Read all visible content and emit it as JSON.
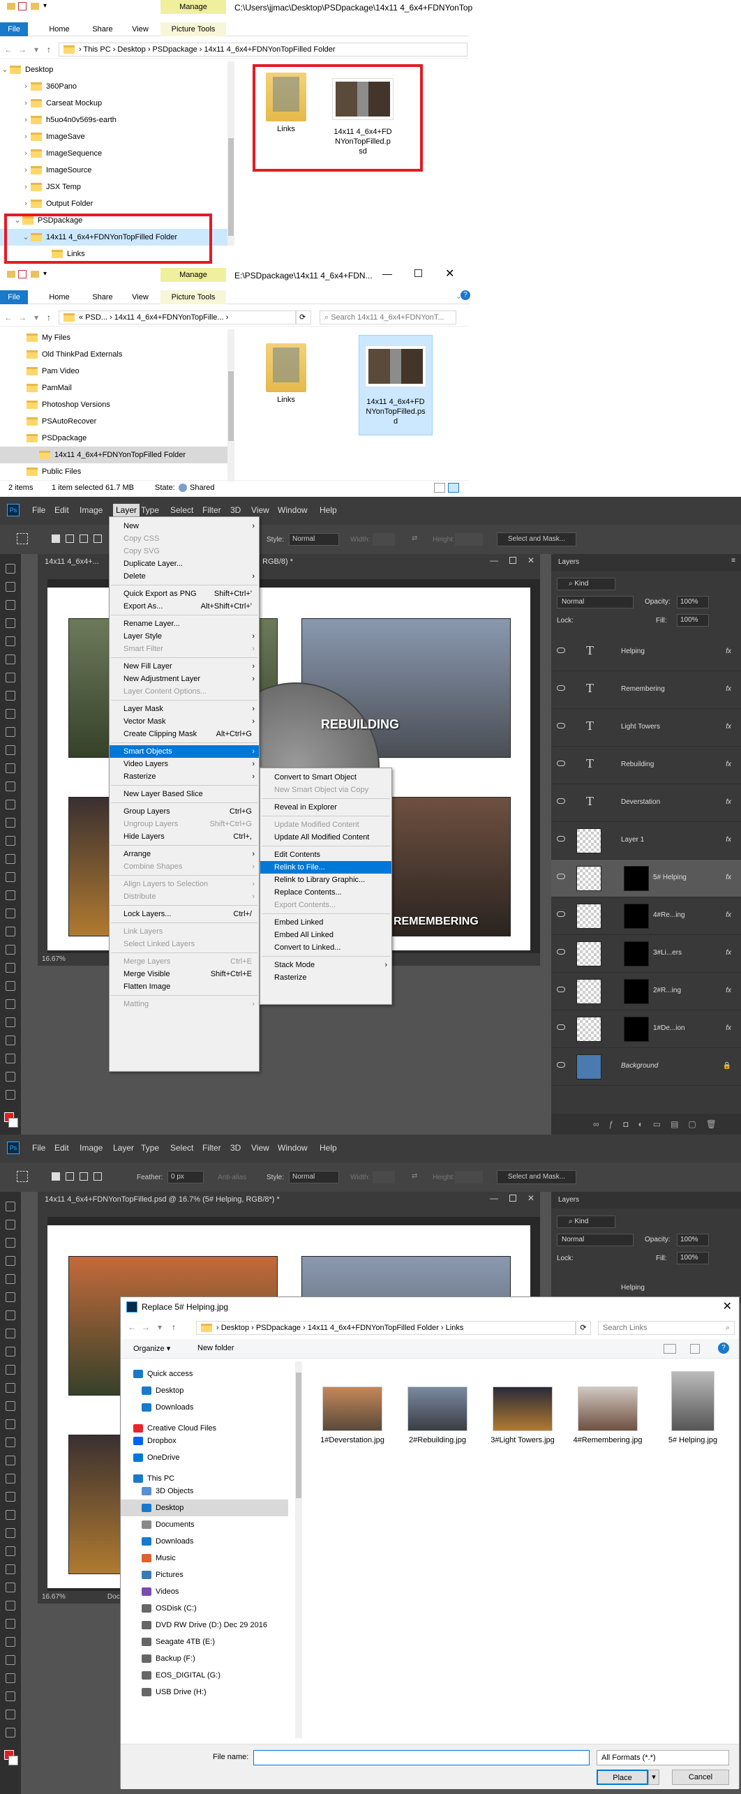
{
  "explorer1": {
    "title_path": "C:\\Users\\jjmac\\Desktop\\PSDpackage\\14x11 4_6x4+FDNYonTop",
    "tabs": [
      "File",
      "Home",
      "Share",
      "View"
    ],
    "manage": "Manage",
    "picture_tools": "Picture Tools",
    "breadcrumb": "›  This PC  ›  Desktop  ›  PSDpackage  ›  14x11 4_6x4+FDNYonTopFilled Folder",
    "tree": [
      "Desktop",
      "360Pano",
      "Carseat Mockup",
      "h5uo4n0v569s-earth",
      "ImageSave",
      "ImageSequence",
      "ImageSource",
      "JSX Temp",
      "Output Folder",
      "PSDpackage",
      "14x11 4_6x4+FDNYonTopFilled Folder",
      "Links"
    ],
    "files": [
      {
        "name": "Links"
      },
      {
        "name": "14x11 4_6x4+FDNYonTopFilled.psd"
      }
    ]
  },
  "explorer2": {
    "title_path": "E:\\PSDpackage\\14x11 4_6x4+FDN...",
    "tabs": [
      "File",
      "Home",
      "Share",
      "View"
    ],
    "manage": "Manage",
    "picture_tools": "Picture Tools",
    "breadcrumb": "«  PSD...  ›  14x11 4_6x4+FDNYonTopFille...  ›",
    "search_placeholder": "Search 14x11 4_6x4+FDNYonT...",
    "tree": [
      "My Files",
      "Old ThinkPad Externals",
      "Pam Video",
      "PamMail",
      "Photoshop Versions",
      "PSAutoRecover",
      "PSDpackage",
      "14x11 4_6x4+FDNYonTopFilled Folder",
      "Public Files"
    ],
    "files": [
      {
        "name": "Links"
      },
      {
        "name": "14x11 4_6x4+FDNYonTopFilled.psd"
      }
    ],
    "status": {
      "items": "2 items",
      "selected": "1 item selected  61.7 MB",
      "state": "State:",
      "shared": "Shared"
    }
  },
  "ps1": {
    "menus": [
      "File",
      "Edit",
      "Image",
      "Layer",
      "Type",
      "Select",
      "Filter",
      "3D",
      "View",
      "Window",
      "Help"
    ],
    "options": {
      "style_label": "Style:",
      "style_val": "Normal",
      "width_label": "Width:",
      "height_label": "Height:",
      "select_mask": "Select and Mask..."
    },
    "doc_title": "14x11 4_6x4+FDNYonTopFilled.psd @ 16.7% (5# Helping, RGB/8*) *",
    "doc_title_partial": "14x11 4_6x4+...",
    "rgb_partial": "RGB/8) *",
    "zoom": "16.67%",
    "canvas_labels": [
      "REBUILDING",
      "REMEMBERING"
    ],
    "layer_menu": [
      {
        "l": "New",
        "a": "›"
      },
      {
        "l": "Copy CSS",
        "d": true
      },
      {
        "l": "Copy SVG",
        "d": true
      },
      {
        "l": "Duplicate Layer..."
      },
      {
        "l": "Delete",
        "a": "›"
      },
      {
        "sep": true
      },
      {
        "l": "Quick Export as PNG",
        "s": "Shift+Ctrl+'"
      },
      {
        "l": "Export As...",
        "s": "Alt+Shift+Ctrl+'"
      },
      {
        "sep": true
      },
      {
        "l": "Rename Layer..."
      },
      {
        "l": "Layer Style",
        "a": "›"
      },
      {
        "l": "Smart Filter",
        "d": true,
        "a": "›"
      },
      {
        "sep": true
      },
      {
        "l": "New Fill Layer",
        "a": "›"
      },
      {
        "l": "New Adjustment Layer",
        "a": "›"
      },
      {
        "l": "Layer Content Options...",
        "d": true
      },
      {
        "sep": true
      },
      {
        "l": "Layer Mask",
        "a": "›"
      },
      {
        "l": "Vector Mask",
        "a": "›"
      },
      {
        "l": "Create Clipping Mask",
        "s": "Alt+Ctrl+G"
      },
      {
        "sep": true
      },
      {
        "l": "Smart Objects",
        "a": "›",
        "h": true
      },
      {
        "l": "Video Layers",
        "a": "›"
      },
      {
        "l": "Rasterize",
        "a": "›"
      },
      {
        "sep": true
      },
      {
        "l": "New Layer Based Slice"
      },
      {
        "sep": true
      },
      {
        "l": "Group Layers",
        "s": "Ctrl+G"
      },
      {
        "l": "Ungroup Layers",
        "s": "Shift+Ctrl+G",
        "d": true
      },
      {
        "l": "Hide Layers",
        "s": "Ctrl+,"
      },
      {
        "sep": true
      },
      {
        "l": "Arrange",
        "a": "›"
      },
      {
        "l": "Combine Shapes",
        "d": true,
        "a": "›"
      },
      {
        "sep": true
      },
      {
        "l": "Align Layers to Selection",
        "d": true,
        "a": "›"
      },
      {
        "l": "Distribute",
        "d": true,
        "a": "›"
      },
      {
        "sep": true
      },
      {
        "l": "Lock Layers...",
        "s": "Ctrl+/"
      },
      {
        "sep": true
      },
      {
        "l": "Link Layers",
        "d": true
      },
      {
        "l": "Select Linked Layers",
        "d": true
      },
      {
        "sep": true
      },
      {
        "l": "Merge Layers",
        "s": "Ctrl+E",
        "d": true
      },
      {
        "l": "Merge Visible",
        "s": "Shift+Ctrl+E"
      },
      {
        "l": "Flatten Image"
      },
      {
        "sep": true
      },
      {
        "l": "Matting",
        "d": true,
        "a": "›"
      }
    ],
    "smart_menu": [
      {
        "l": "Convert to Smart Object"
      },
      {
        "l": "New Smart Object via Copy",
        "d": true
      },
      {
        "sep": true
      },
      {
        "l": "Reveal in Explorer"
      },
      {
        "sep": true
      },
      {
        "l": "Update Modified Content",
        "d": true
      },
      {
        "l": "Update All Modified Content"
      },
      {
        "sep": true
      },
      {
        "l": "Edit Contents"
      },
      {
        "l": "Relink to File...",
        "h": true
      },
      {
        "l": "Relink to Library Graphic..."
      },
      {
        "l": "Replace Contents..."
      },
      {
        "l": "Export Contents...",
        "d": true
      },
      {
        "sep": true
      },
      {
        "l": "Embed Linked"
      },
      {
        "l": "Embed All Linked"
      },
      {
        "l": "Convert to Linked..."
      },
      {
        "sep": true
      },
      {
        "l": "Stack Mode",
        "a": "›"
      },
      {
        "l": "Rasterize"
      }
    ],
    "layers_panel": {
      "title": "Layers",
      "kind": "Kind",
      "blend": "Normal",
      "opacity_label": "Opacity:",
      "opacity": "100%",
      "lock_label": "Lock:",
      "fill_label": "Fill:",
      "fill": "100%",
      "layers": [
        {
          "name": "Helping",
          "type": "text"
        },
        {
          "name": "Remembering",
          "type": "text"
        },
        {
          "name": "Light Towers",
          "type": "text"
        },
        {
          "name": "Rebuilding",
          "type": "text"
        },
        {
          "name": "Deverstation",
          "type": "text"
        },
        {
          "name": "Layer 1",
          "type": "pixel"
        },
        {
          "name": "5# Helping",
          "type": "smart"
        },
        {
          "name": "4#Re...ing",
          "type": "smart"
        },
        {
          "name": "3#Li...ers",
          "type": "smart"
        },
        {
          "name": "2#R...ing",
          "type": "smart"
        },
        {
          "name": "1#De...ion",
          "type": "smart"
        },
        {
          "name": "Background",
          "type": "bg"
        }
      ],
      "fx": "fx"
    }
  },
  "ps2": {
    "menus": [
      "File",
      "Edit",
      "Image",
      "Layer",
      "Type",
      "Select",
      "Filter",
      "3D",
      "View",
      "Window",
      "Help"
    ],
    "options": {
      "feather_label": "Feather:",
      "feather_val": "0 px",
      "antialias": "Anti-alias",
      "style_label": "Style:",
      "style_val": "Normal",
      "width_label": "Width:",
      "height_label": "Height:",
      "select_mask": "Select and Mask..."
    },
    "doc_title": "14x11 4_6x4+FDNYonTopFilled.psd @ 16.7% (5# Helping, RGB/8*) *",
    "zoom": "16.67%",
    "doc_partial": "Doc: 3",
    "layers_panel": {
      "title": "Layers",
      "kind": "Kind",
      "blend": "Normal",
      "opacity_label": "Opacity:",
      "opacity": "100%",
      "lock_label": "Lock:",
      "fill_label": "Fill:",
      "fill": "100%",
      "partial": "Helping"
    },
    "dialog": {
      "title": "Replace 5# Helping.jpg",
      "breadcrumb": "›  Desktop  ›  PSDpackage  ›  14x11 4_6x4+FDNYonTopFilled Folder  ›  Links",
      "search": "Search Links",
      "organize": "Organize ▾",
      "new_folder": "New folder",
      "nav": [
        "Quick access",
        "Desktop",
        "Downloads",
        "Creative Cloud Files",
        "Dropbox",
        "OneDrive",
        "This PC",
        "3D Objects",
        "Desktop",
        "Documents",
        "Downloads",
        "Music",
        "Pictures",
        "Videos",
        "OSDisk (C:)",
        "DVD RW Drive (D:) Dec 29 2016",
        "Seagate 4TB (E:)",
        "Backup (F:)",
        "EOS_DIGITAL (G:)",
        "USB Drive (H:)"
      ],
      "files": [
        "1#Deverstation.jpg",
        "2#Rebuilding.jpg",
        "3#Light Towers.jpg",
        "4#Remembering.jpg",
        "5# Helping.jpg"
      ],
      "filename_label": "File name:",
      "filter": "All Formats (*.*)",
      "place": "Place",
      "cancel": "Cancel"
    }
  },
  "colors": {
    "explorer_blue": "#1979ca",
    "manage_yellow": "#f0ef9e",
    "highlight": "#0078d7",
    "red_outline": "#e31b23",
    "ps_bg": "#535353"
  },
  "icons": [
    "folder-icon",
    "chevron-right-icon",
    "back-arrow-icon",
    "forward-arrow-icon",
    "up-arrow-icon",
    "refresh-icon",
    "search-icon",
    "eye-icon",
    "text-layer-icon",
    "close-icon",
    "minimize-icon",
    "maximize-icon"
  ]
}
